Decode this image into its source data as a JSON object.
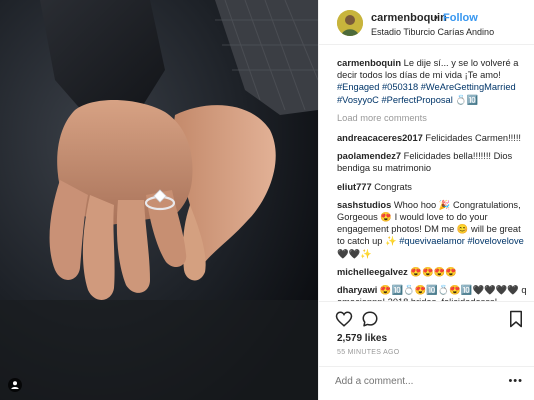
{
  "post": {
    "username": "carmenboquin",
    "dot": "•",
    "follow_label": "Follow",
    "location": "Estadio Tiburcio Carías Andino"
  },
  "caption": {
    "username": "carmenboquin",
    "text": "Le dije sí... y se lo volveré a decir todos los días de mi vida ¡Te amo!",
    "hashtags": "#Engaged #050318 #WeAreGettingMarried #VosyyoC #PerfectProposal",
    "emoji": "💍🔟"
  },
  "load_more_label": "Load more comments",
  "comments": [
    {
      "user": "andreacaceres2017",
      "text": "Felicidades Carmen!!!!!"
    },
    {
      "user": "paolamendez7",
      "text": "Felicidades bella!!!!!!! Dios bendiga su matrimonio"
    },
    {
      "user": "eliut777",
      "text": "Congrats"
    },
    {
      "user": "sashstudios",
      "text": "Whoo hoo 🎉 Congratulations, Gorgeous 😍 I would love to do your engagement photos! DM me 😊 will be great to catch up ✨",
      "tags": "#quevivaelamor #lovelovelove",
      "emoji": "🖤🖤✨"
    },
    {
      "user": "michelleegalvez",
      "text": "😍😍😍😍"
    },
    {
      "user": "dharyawi",
      "text": "😍🔟💍😍🔟💍😍🔟🖤🖤🖤🖤 q emocionnn! 2018 brides, felicidadesss!"
    }
  ],
  "likes": "2,579 likes",
  "time": "55 MINUTES AGO",
  "add_comment_placeholder": "Add a comment...",
  "more_label": "•••",
  "icons": {
    "like": "heart-icon",
    "comment": "comment-bubble-icon",
    "save": "bookmark-icon",
    "tagged": "person-tag-icon"
  },
  "colors": {
    "accent": "#3897f0",
    "hashtag": "#003569",
    "muted": "#999999",
    "text": "#262626"
  }
}
